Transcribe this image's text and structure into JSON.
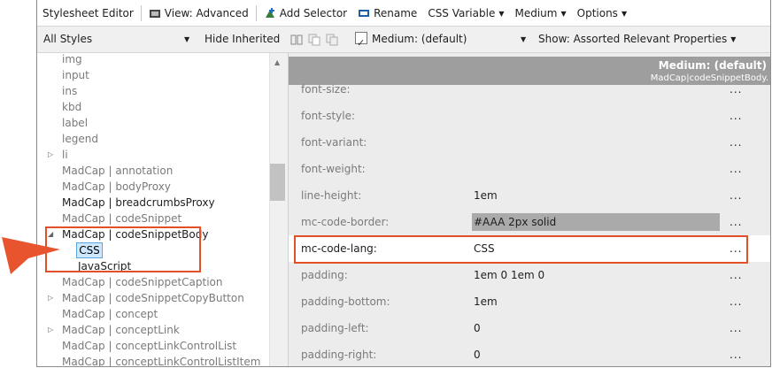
{
  "toolbar": {
    "title": "Stylesheet Editor",
    "view": "View: Advanced",
    "add_selector": "Add Selector",
    "rename": "Rename",
    "css_variable": "CSS Variable",
    "medium": "Medium",
    "options": "Options"
  },
  "filterbar": {
    "styles_select": "All Styles",
    "hide_inherited": "Hide Inherited",
    "medium_label": "Medium: (default)",
    "show_select": "Show: Assorted Relevant Properties"
  },
  "tree": [
    {
      "label": "img",
      "gray": true,
      "exp": ""
    },
    {
      "label": "input",
      "gray": true,
      "exp": ""
    },
    {
      "label": "ins",
      "gray": true,
      "exp": ""
    },
    {
      "label": "kbd",
      "gray": true,
      "exp": ""
    },
    {
      "label": "label",
      "gray": true,
      "exp": ""
    },
    {
      "label": "legend",
      "gray": true,
      "exp": ""
    },
    {
      "label": "li",
      "gray": true,
      "exp": "▷"
    },
    {
      "label": "MadCap | annotation",
      "gray": true,
      "exp": ""
    },
    {
      "label": "MadCap | bodyProxy",
      "gray": true,
      "exp": ""
    },
    {
      "label": "MadCap | breadcrumbsProxy",
      "gray": false,
      "exp": ""
    },
    {
      "label": "MadCap | codeSnippet",
      "gray": true,
      "exp": ""
    },
    {
      "label": "MadCap | codeSnippetBody",
      "gray": false,
      "exp": "◢"
    },
    {
      "label": "CSS",
      "gray": false,
      "exp": "",
      "child": true,
      "selected": true
    },
    {
      "label": "JavaScript",
      "gray": false,
      "exp": "",
      "child": true
    },
    {
      "label": "MadCap | codeSnippetCaption",
      "gray": true,
      "exp": ""
    },
    {
      "label": "MadCap | codeSnippetCopyButton",
      "gray": true,
      "exp": "▷"
    },
    {
      "label": "MadCap | concept",
      "gray": true,
      "exp": ""
    },
    {
      "label": "MadCap | conceptLink",
      "gray": true,
      "exp": "▷"
    },
    {
      "label": "MadCap | conceptLinkControlList",
      "gray": true,
      "exp": ""
    },
    {
      "label": "MadCap | conceptLinkControlListItem",
      "gray": true,
      "exp": ""
    }
  ],
  "panel": {
    "medium": "Medium: (default)",
    "selector": "MadCap|codeSnippetBody.",
    "properties": [
      {
        "name": "font-size:",
        "value": ""
      },
      {
        "name": "font-style:",
        "value": ""
      },
      {
        "name": "font-variant:",
        "value": ""
      },
      {
        "name": "font-weight:",
        "value": ""
      },
      {
        "name": "line-height:",
        "value": "1em"
      },
      {
        "name": "mc-code-border:",
        "value": "#AAA 2px solid",
        "swatch": "#aaaaaa"
      },
      {
        "name": "mc-code-lang:",
        "value": "CSS",
        "emph": true
      },
      {
        "name": "padding:",
        "value": "1em 0 1em 0"
      },
      {
        "name": "padding-bottom:",
        "value": "1em"
      },
      {
        "name": "padding-left:",
        "value": "0"
      },
      {
        "name": "padding-right:",
        "value": "0"
      }
    ],
    "dots": "..."
  },
  "colors": {
    "highlight": "#e2502a",
    "selection": "#cde8ff",
    "header": "#9e9e9e"
  }
}
